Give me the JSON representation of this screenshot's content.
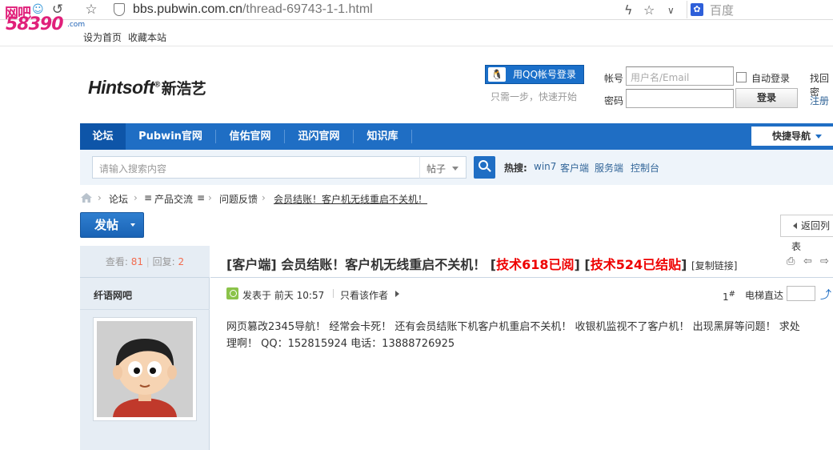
{
  "browser": {
    "url_host": "bbs.pubwin.com.cn",
    "url_path": "/thread-69743-1-1.html",
    "search_engine": "百度",
    "watermark": {
      "line1": "网吧",
      "line2": "58390",
      "domain": ".com"
    }
  },
  "bookmarks": [
    "设为首页",
    "收藏本站"
  ],
  "site": {
    "logo_text": "Hintsoft",
    "logo_reg": "®",
    "logo_cn": "新浩艺"
  },
  "login": {
    "qq_button": "用QQ帐号登录",
    "qq_tip": "只需一步，快速开始",
    "account_label": "帐号",
    "account_placeholder": "用户名/Email",
    "password_label": "密码",
    "auto_login": "自动登录",
    "login_button": "登录",
    "find_password": "找回密",
    "register": "注册"
  },
  "nav": {
    "items": [
      "论坛",
      "Pubwin官网",
      "信佑官网",
      "迅闪官网",
      "知识库"
    ],
    "quick_nav": "快捷导航"
  },
  "search": {
    "placeholder": "请输入搜索内容",
    "type": "帖子",
    "hot_label": "热搜:",
    "hot_terms": [
      "win7",
      "客户端",
      "服务端",
      "控制台"
    ]
  },
  "breadcrumb": [
    "论坛",
    "产品交流",
    "问题反馈",
    "会员结账！客户机无线重启不关机！"
  ],
  "actions": {
    "post_button": "发帖",
    "back_list": "返回列表"
  },
  "thread": {
    "views_label": "查看:",
    "views": "81",
    "replies_label": "回复:",
    "replies": "2",
    "title_prefix": "[客户端]",
    "title": "会员结账！客户机无线重启不关机！",
    "tag1": "技术618已阅",
    "tag2": "技术524已结贴",
    "copy_link": "[复制链接]",
    "author": "纤语网吧",
    "post_time": "发表于 前天 10:57",
    "author_only": "只看该作者",
    "floor": "1",
    "floor_sup": "#",
    "elevator": "电梯直达",
    "body": "网页篡改2345导航！ 经常会卡死！ 还有会员结账下机客户机重启不关机！ 收银机监视不了客户机！ 出现黑屏等问题！ 求处理啊！ QQ：152815924 电话：13888726925"
  }
}
